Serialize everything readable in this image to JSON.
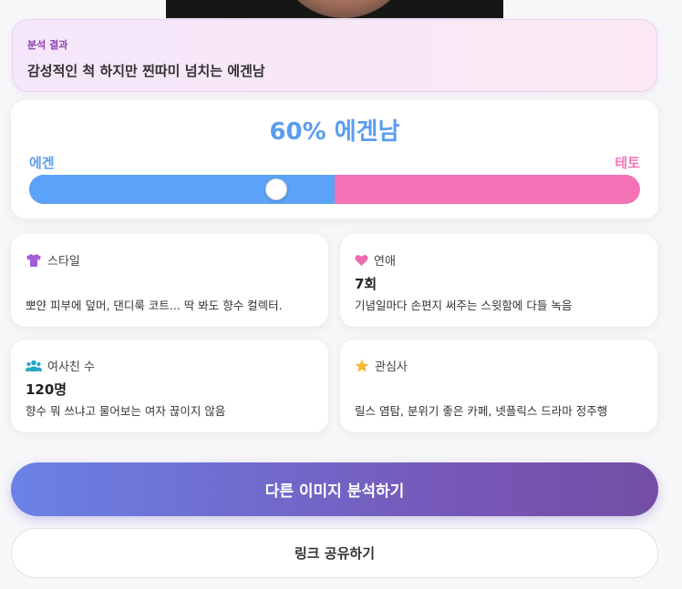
{
  "summary": {
    "label": "분석 결과",
    "text": "감성적인 척 하지만 찐따미 넘치는 에겐남"
  },
  "meter": {
    "title": "60% 에겐남",
    "left_label": "에겐",
    "right_label": "테토",
    "egen_fraction": 0.5,
    "knob_fraction": 0.405,
    "left_color": "#5ba3f8",
    "right_color": "#f472b6"
  },
  "cards": {
    "style": {
      "icon": "shirt-icon",
      "title": "스타일",
      "value": "",
      "desc": "뽀얀 피부에 덮머, 댄디룩 코트... 딱 봐도 향수 컬렉터."
    },
    "romance": {
      "icon": "heart-icon",
      "title": "연애",
      "value": "7회",
      "desc": "기념일마다 손편지 써주는 스윗함에 다들 녹음"
    },
    "female_friends": {
      "icon": "people-icon",
      "title": "여사친 수",
      "value": "120명",
      "desc": "향수 뭐 쓰냐고 물어보는 여자 끊이지 않음"
    },
    "interests": {
      "icon": "star-icon",
      "title": "관심사",
      "value": "",
      "desc": "릴스 염탐, 분위기 좋은 카페, 넷플릭스 드라마 정주행"
    }
  },
  "actions": {
    "retry_label": "다른 이미지 분석하기",
    "share_label": "링크 공유하기"
  },
  "colors": {
    "accent_blue": "#5b9cf0",
    "accent_pink": "#f472b6",
    "button_gradient_start": "#6a82e6",
    "button_gradient_end": "#744ea4"
  }
}
